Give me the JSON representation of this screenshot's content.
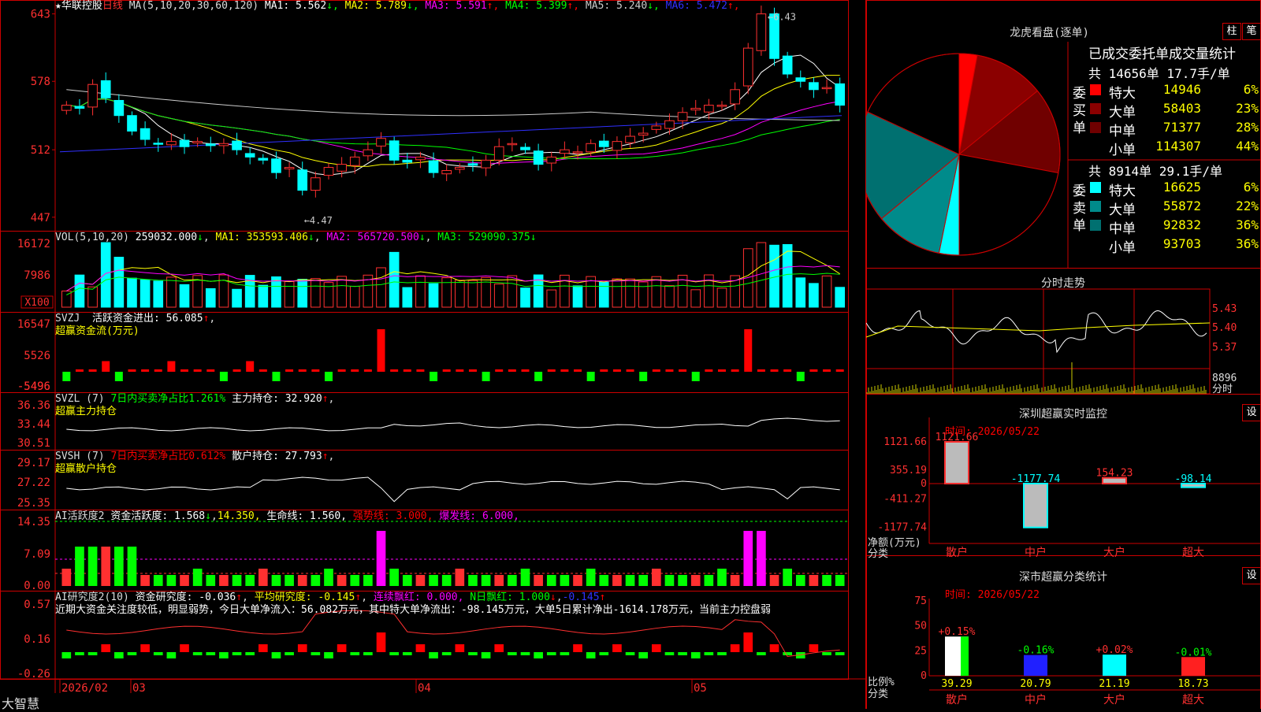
{
  "stock": {
    "name": "华联控股",
    "period": "日线",
    "ma_header": "MA(5,10,20,30,60,120)",
    "ma": [
      {
        "k": "MA1:",
        "v": "5.562",
        "a": "↓",
        "c": "#ffffff"
      },
      {
        "k": "MA2:",
        "v": "5.789",
        "a": "↓",
        "c": "#ffff00"
      },
      {
        "k": "MA3:",
        "v": "5.591",
        "a": "↑",
        "c": "#ff00ff"
      },
      {
        "k": "MA4:",
        "v": "5.399",
        "a": "↑",
        "c": "#00ff00"
      },
      {
        "k": "MA5:",
        "v": "5.240",
        "a": "↓",
        "c": "#cccccc"
      },
      {
        "k": "MA6:",
        "v": "5.472",
        "a": "↑",
        "c": "#3030ff"
      }
    ],
    "price_ticks": [
      "643",
      "578",
      "512",
      "447"
    ],
    "high_label": "6.43",
    "low_label": "4.47"
  },
  "vol": {
    "label": "VOL(5,10,20)",
    "value": "259032.000",
    "arrow": "↓",
    "ma1": "MA1: 353593.406",
    "ma2": "MA2: 565720.500",
    "ma3": "MA3: 529090.375",
    "ticks": [
      "16172",
      "7986"
    ],
    "unit": "X100"
  },
  "svzj": {
    "label": "SVZJ",
    "line": "活跃资金进出: 56.085",
    "arrow": "↑",
    "sub": "超赢资金流(万元)",
    "ticks": [
      "16547",
      "5526",
      "-5496"
    ]
  },
  "svzl": {
    "label": "SVZL (7)",
    "t1": "7日内买卖净占比1.261%",
    "t2": "主力持仓: 32.920",
    "arrow": "↑",
    "sub": "超赢主力持仓",
    "ticks": [
      "36.36",
      "33.44",
      "30.51"
    ]
  },
  "svsh": {
    "label": "SVSH (7)",
    "t1": "7日内买卖净占比0.612%",
    "t2": "散户持仓: 27.793",
    "arrow": "↑",
    "sub": "超赢散户持仓",
    "ticks": [
      "29.17",
      "27.22",
      "25.35"
    ]
  },
  "ai1": {
    "label": "AI活跃度2",
    "t1": "资金活跃度: 1.568",
    "t2": "14.350,",
    "t3": "生命线: 1.560,",
    "t4": "强势线: 3.000,",
    "t5": "爆发线: 6.000,",
    "ticks": [
      "14.35",
      "7.09",
      "0.00"
    ]
  },
  "ai2": {
    "label": "AI研究度2(10)",
    "t1": "资金研究度: -0.036",
    "t2": "平均研究度: -0.145",
    "t3": "连续飘红: 0.000,",
    "t4": "N日飘红: 1.000",
    "t5": "-0.145",
    "ticks": [
      "0.57",
      "0.16",
      "-0.26"
    ],
    "comment": "近期大资金关注度较低，明显弱势，今日大单净流入：56.082万元，其中特大单净流出：-98.145万元，大单5日累计净出-1614.178万元，当前主力控盘弱"
  },
  "dates": [
    "2026/02",
    "03",
    "04",
    "05"
  ],
  "brand": "大智慧",
  "lhb": {
    "title": "龙虎看盘(逐单)",
    "btn_zhu": "柱",
    "btn_bi": "笔",
    "header": "已成交委托单成交量统计",
    "buy": {
      "summary": "共 14656单 17.7手/单",
      "side": "委买单",
      "rows": [
        {
          "n": "特大",
          "v": "14946",
          "p": "6%",
          "c": "#ff0000"
        },
        {
          "n": "大单",
          "v": "58403",
          "p": "23%",
          "c": "#8b0000"
        },
        {
          "n": "中单",
          "v": "71377",
          "p": "28%",
          "c": "#700000"
        },
        {
          "n": "小单",
          "v": "114307",
          "p": "44%",
          "c": "#000000"
        }
      ]
    },
    "sell": {
      "summary": "共 8914单 29.1手/单",
      "side": "委卖单",
      "rows": [
        {
          "n": "特大",
          "v": "16625",
          "p": "6%",
          "c": "#00ffff"
        },
        {
          "n": "大单",
          "v": "55872",
          "p": "22%",
          "c": "#008b8b"
        },
        {
          "n": "中单",
          "v": "92832",
          "p": "36%",
          "c": "#007070"
        },
        {
          "n": "小单",
          "v": "93703",
          "p": "36%",
          "c": "#000000"
        }
      ]
    }
  },
  "fenshi": {
    "title": "分时走势",
    "ticks": [
      "5.43",
      "5.40",
      "5.37"
    ],
    "vol_tick": "8896",
    "vol_label": "分时"
  },
  "monitor": {
    "title": "深圳超赢实时监控",
    "btn": "设",
    "time": "时间: 2026/05/22",
    "ticks": [
      "1121.66",
      "355.19",
      "0",
      "-411.27",
      "-1177.74"
    ],
    "ylabel": "净额(万元)",
    "xlabel": "分类",
    "bars": [
      {
        "n": "散户",
        "v": 1121.66,
        "lbl": "1121.66"
      },
      {
        "n": "中户",
        "v": -1177.74,
        "lbl": "-1177.74"
      },
      {
        "n": "大户",
        "v": 154.23,
        "lbl": "154.23"
      },
      {
        "n": "超大",
        "v": -98.14,
        "lbl": "-98.14"
      }
    ]
  },
  "classify": {
    "title": "深市超赢分类统计",
    "btn": "设",
    "time": "时间: 2026/05/22",
    "ticks": [
      "75",
      "50",
      "25",
      "0"
    ],
    "ylabel": "比例%",
    "xlabel": "分类",
    "bars": [
      {
        "n": "散户",
        "v": 39.29,
        "lbl": "39.29",
        "chg": "+0.15%",
        "c": "#ffffff",
        "c2": "#00ff00"
      },
      {
        "n": "中户",
        "v": 20.79,
        "lbl": "20.79",
        "chg": "-0.16%",
        "c": "#2020ff",
        "c2": "#2020ff"
      },
      {
        "n": "大户",
        "v": 21.19,
        "lbl": "21.19",
        "chg": "+0.02%",
        "c": "#00ffff",
        "c2": "#00ffff"
      },
      {
        "n": "超大",
        "v": 18.73,
        "lbl": "18.73",
        "chg": "-0.01%",
        "c": "#ff2020",
        "c2": "#ff2020"
      }
    ]
  }
}
